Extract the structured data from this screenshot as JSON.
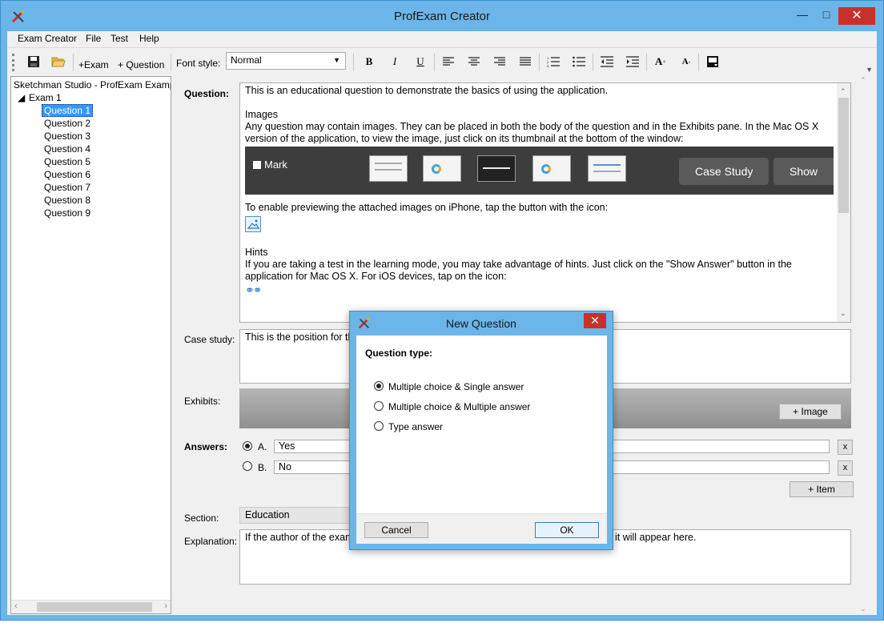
{
  "window": {
    "title": "ProfExam Creator",
    "minimize": "—",
    "maximize": "□",
    "close": "✕"
  },
  "menu": [
    "Exam Creator",
    "File",
    "Test",
    "Help"
  ],
  "toolbar": {
    "save_icon": "save-icon",
    "open_icon": "folder-open-icon",
    "add_exam": "+Exam",
    "add_question": "+ Question",
    "font_style_label": "Font style:",
    "font_style_value": "Normal",
    "bold": "B",
    "italic": "I",
    "underline": "U",
    "superscript": "A",
    "subscript": "A"
  },
  "tree": {
    "root": "Sketchman Studio - ProfExam Examp",
    "exam": "Exam 1",
    "questions": [
      "Question 1",
      "Question 2",
      "Question 3",
      "Question 4",
      "Question 5",
      "Question 6",
      "Question 7",
      "Question 8",
      "Question 9"
    ],
    "selected_index": 0
  },
  "editor": {
    "question_label": "Question:",
    "question": {
      "intro": "This is an educational question to demonstrate the basics of using the application.",
      "images_heading": "Images",
      "images_text": "Any question may contain images. They can be placed in both the body of the question and in the Exhibits pane. In the Mac OS X version of the application, to view the image, just click on its thumbnail at the bottom of the window:",
      "band_mark": "Mark",
      "band_case_study": "Case Study",
      "band_show_answer": "Show Ans",
      "iphone_text": "To enable previewing the attached images on iPhone, tap the button with the icon:",
      "hints_heading": "Hints",
      "hints_text": "If you are taking a test in the learning mode, you may take advantage of hints. Just click on the \"Show Answer\" button in the application for Mac OS X. For iOS devices, tap on the icon:"
    },
    "case_study_label": "Case study:",
    "case_study_text": "This is the position for th",
    "exhibits_label": "Exhibits:",
    "add_image": "+ Image",
    "answers_label": "Answers:",
    "answers": [
      {
        "letter": "A.",
        "text": "Yes",
        "selected": true
      },
      {
        "letter": "B.",
        "text": "No",
        "selected": false
      }
    ],
    "remove_answer": "x",
    "add_item": "+ Item",
    "section_label": "Section:",
    "section_value": "Education",
    "explanation_label": "Explanation:",
    "explanation_left": "If the author of the exam",
    "explanation_right": "it will appear here."
  },
  "dialog": {
    "title": "New Question",
    "close": "✕",
    "question_type_label": "Question type:",
    "options": [
      "Multiple choice & Single answer",
      "Multiple choice & Multiple answer",
      "Type answer"
    ],
    "selected_option": 0,
    "cancel": "Cancel",
    "ok": "OK"
  }
}
